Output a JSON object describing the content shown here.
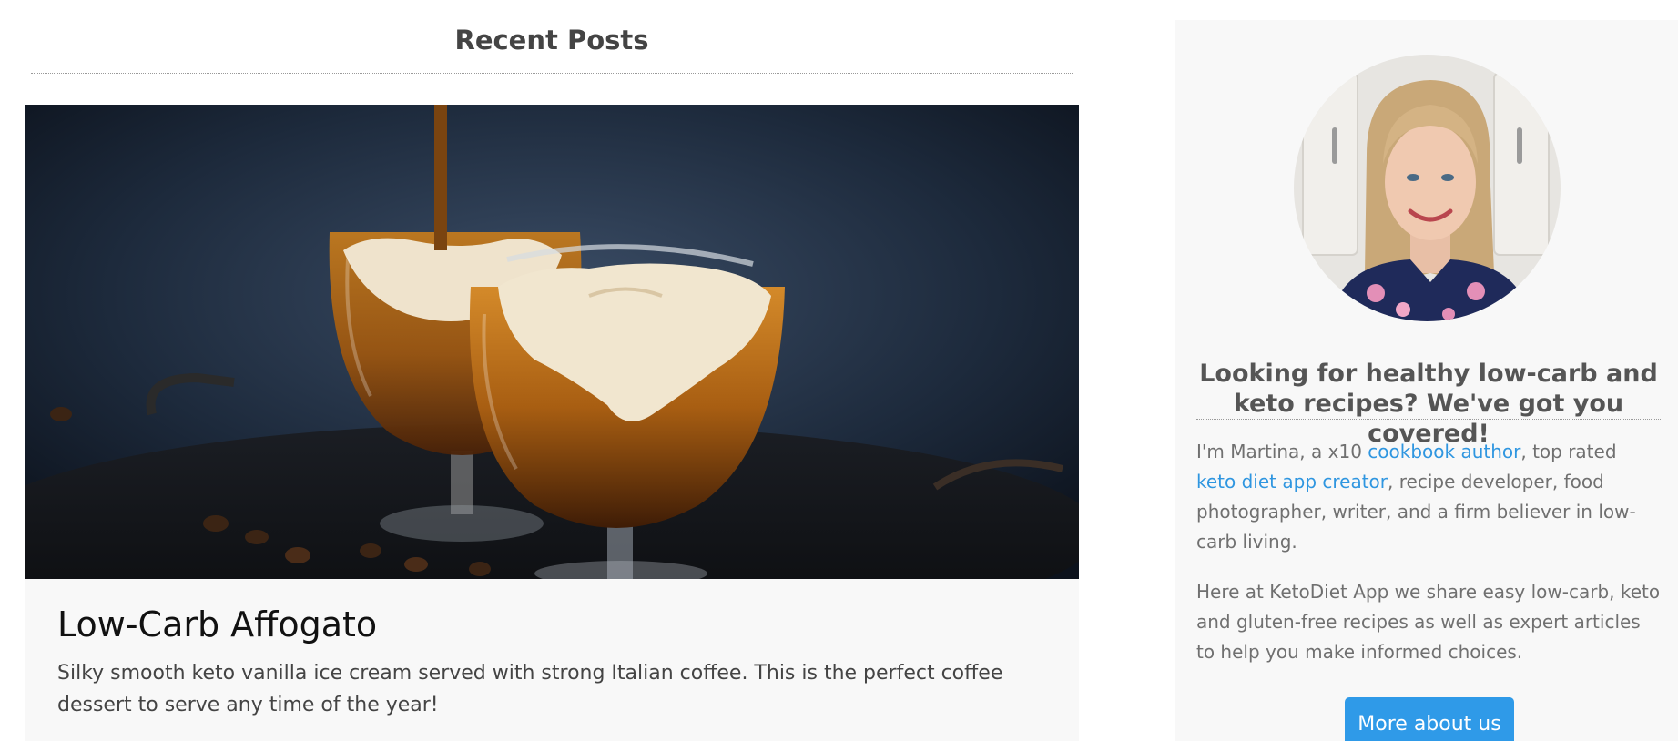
{
  "main": {
    "section_title": "Recent Posts",
    "post": {
      "image_alt": "Two glasses of affogato with ice cream and coffee being poured",
      "title": "Low-Carb Affogato",
      "excerpt": "Silky smooth keto vanilla ice cream served with strong Italian coffee. This is the perfect coffee dessert to serve any time of the year!"
    }
  },
  "sidebar": {
    "avatar_alt": "Portrait of Martina",
    "heading": "Looking for healthy low-carb and keto recipes? We've got you covered!",
    "about": {
      "intro": "I'm Martina, a x10 ",
      "link_cookbook": "cookbook author",
      "mid": ", top rated ",
      "link_app": "keto diet app creator",
      "end": ", recipe developer, food photographer, writer, and a firm believer in low-carb living."
    },
    "paragraph_2": "Here at KetoDiet App we share easy low-carb, keto and gluten-free recipes as well as expert articles to help you make informed choices.",
    "button_label": "More about us"
  },
  "colors": {
    "link": "#2f96e0",
    "button": "#2f9ae8",
    "card_bg": "#f8f8f8"
  }
}
